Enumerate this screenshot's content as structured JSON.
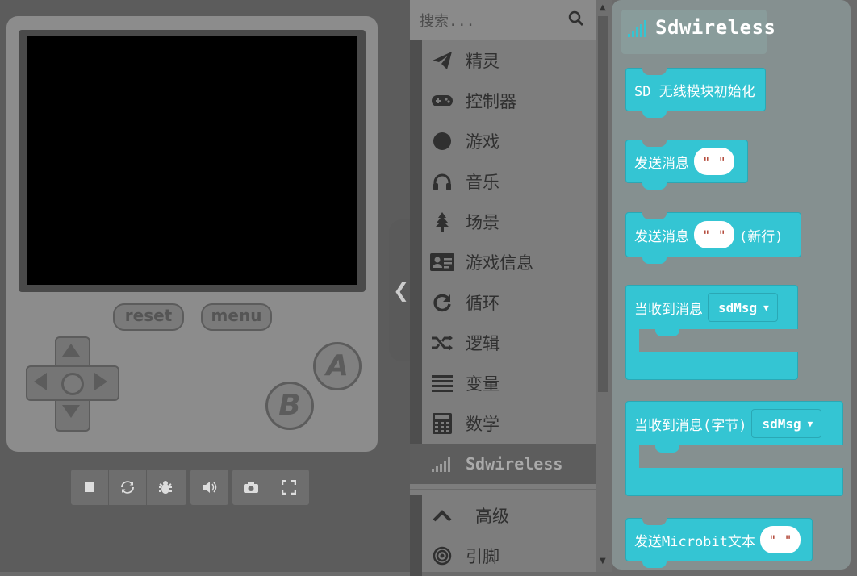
{
  "simulator": {
    "reset_label": "reset",
    "menu_label": "menu",
    "a_label": "A",
    "b_label": "B",
    "toolbar": [
      "stop-icon",
      "restart-icon",
      "debug-icon",
      "sound-icon",
      "screenshot-icon",
      "fullscreen-icon"
    ]
  },
  "toolbox": {
    "search_placeholder": "搜索...",
    "categories": [
      {
        "label": "精灵",
        "icon": "paper-plane-icon"
      },
      {
        "label": "控制器",
        "icon": "gamepad-icon"
      },
      {
        "label": "游戏",
        "icon": "circle-icon"
      },
      {
        "label": "音乐",
        "icon": "headphones-icon"
      },
      {
        "label": "场景",
        "icon": "tree-icon"
      },
      {
        "label": "游戏信息",
        "icon": "id-card-icon"
      },
      {
        "label": "循环",
        "icon": "refresh-icon"
      },
      {
        "label": "逻辑",
        "icon": "shuffle-icon"
      },
      {
        "label": "变量",
        "icon": "list-icon"
      },
      {
        "label": "数学",
        "icon": "calculator-icon"
      },
      {
        "label": "Sdwireless",
        "icon": "signal-icon"
      }
    ],
    "advanced_label": "高级",
    "pins_label": "引脚"
  },
  "flyout": {
    "title": "Sdwireless",
    "blocks": {
      "init": "SD 无线模块初始化",
      "send": "发送消息",
      "send_str": "\"  \"",
      "send_newline": "发送消息",
      "newline_suffix": "(新行)",
      "on_receive": "当收到消息",
      "on_receive_var": "sdMsg",
      "on_receive_bytes": "当收到消息(字节)",
      "on_receive_bytes_var": "sdMsg",
      "send_microbit": "发送Microbit文本"
    }
  },
  "colors": {
    "block": "#34c5d3",
    "selected_category": "#5d5d5d"
  }
}
